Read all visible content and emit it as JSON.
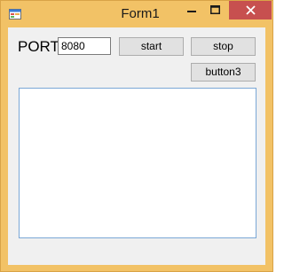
{
  "window": {
    "title": "Form1",
    "accent_color": "#f2c266",
    "close_color": "#c7504f"
  },
  "form": {
    "port_label": "PORT",
    "port_value": "8080",
    "start_label": "start",
    "stop_label": "stop",
    "button3_label": "button3",
    "output_text": ""
  },
  "icons": {
    "app": "form-app-icon",
    "minimize": "minimize-icon",
    "maximize": "maximize-icon",
    "close": "close-icon"
  }
}
